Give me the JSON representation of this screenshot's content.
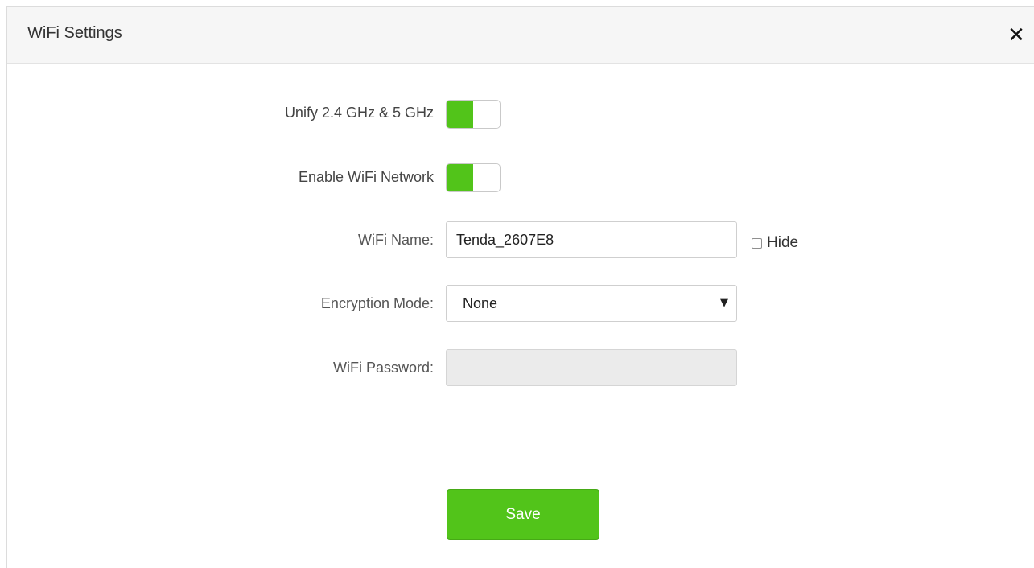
{
  "dialog": {
    "title": "WiFi Settings",
    "close_icon": "close-icon"
  },
  "form": {
    "unify": {
      "label": "Unify 2.4 GHz & 5 GHz",
      "enabled": true
    },
    "enable_wifi": {
      "label": "Enable WiFi Network",
      "enabled": true
    },
    "wifi_name": {
      "label": "WiFi Name:",
      "value": "Tenda_2607E8",
      "hide_label": "Hide",
      "hide_checked": false
    },
    "encryption": {
      "label": "Encryption Mode:",
      "selected": "None"
    },
    "password": {
      "label": "WiFi Password:",
      "value": "",
      "disabled": true
    },
    "save_label": "Save"
  },
  "colors": {
    "accent": "#52c41a",
    "header_bg": "#f6f6f6",
    "disabled_bg": "#ebebeb"
  }
}
